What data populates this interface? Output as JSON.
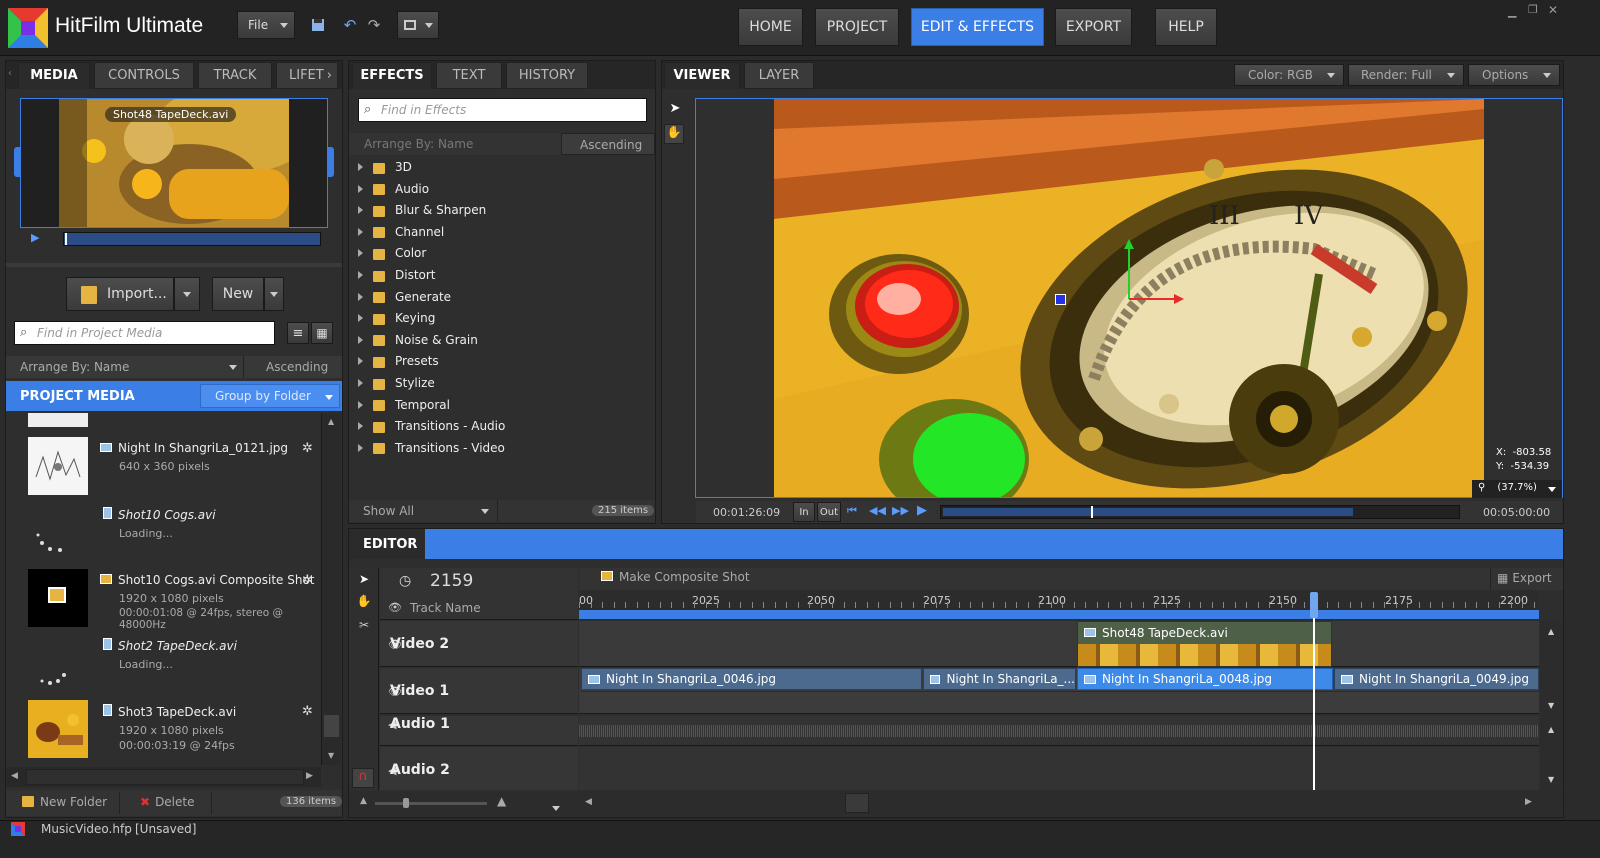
{
  "app": {
    "title": "HitFilm Ultimate",
    "file_menu": "File"
  },
  "nav": {
    "tabs": [
      "HOME",
      "PROJECT",
      "EDIT & EFFECTS",
      "EXPORT",
      "HELP"
    ],
    "active": "EDIT & EFFECTS"
  },
  "left_tabs": [
    "MEDIA",
    "CONTROLS",
    "TRACK",
    "LIFET"
  ],
  "preview": {
    "label": "Shot48 TapeDeck.avi"
  },
  "media_buttons": {
    "import": "Import...",
    "new": "New"
  },
  "media_search": {
    "placeholder": "Find in Project Media"
  },
  "media_arrange": {
    "label": "Arrange By: Name",
    "order": "Ascending"
  },
  "project_media": {
    "title": "PROJECT MEDIA",
    "group": "Group by Folder"
  },
  "media_items": [
    {
      "name": "Night In ShangriLa_0121.jpg",
      "line1": "640 x 360 pixels",
      "line2": "",
      "italic": false
    },
    {
      "name": "Shot10 Cogs.avi",
      "line1": "Loading...",
      "line2": "",
      "italic": true
    },
    {
      "name": "Shot10 Cogs.avi Composite Shot",
      "line1": "1920 x 1080 pixels",
      "line2": "00:00:01:08 @ 24fps, stereo @ 48000Hz",
      "italic": false
    },
    {
      "name": "Shot2 TapeDeck.avi",
      "line1": "Loading...",
      "line2": "",
      "italic": true
    },
    {
      "name": "Shot3 TapeDeck.avi",
      "line1": "1920 x 1080 pixels",
      "line2": "00:00:03:19 @ 24fps",
      "italic": false
    }
  ],
  "media_footer": {
    "new_folder": "New Folder",
    "delete": "Delete",
    "count": "136 items"
  },
  "effects_tabs": [
    "EFFECTS",
    "TEXT",
    "HISTORY"
  ],
  "effects_search": {
    "placeholder": "Find in Effects"
  },
  "effects_arrange": {
    "label": "Arrange By: Name",
    "order": "Ascending"
  },
  "effect_folders": [
    "3D",
    "Audio",
    "Blur & Sharpen",
    "Channel",
    "Color",
    "Distort",
    "Generate",
    "Keying",
    "Noise & Grain",
    "Presets",
    "Stylize",
    "Temporal",
    "Transitions - Audio",
    "Transitions - Video"
  ],
  "effects_footer": {
    "show": "Show All",
    "count": "215 items"
  },
  "viewer_tabs": [
    "VIEWER",
    "LAYER"
  ],
  "viewer_options": {
    "color": "Color: RGB",
    "render": "Render: Full",
    "options": "Options"
  },
  "viewer_coords": {
    "x": "X:  -803.58",
    "y": "Y:  -534.39",
    "zoom": "(37.7%)"
  },
  "transport": {
    "current": "00:01:26:09",
    "in": "In",
    "out": "Out",
    "duration": "00:05:00:00"
  },
  "editor": {
    "title": "EDITOR",
    "frame": "2159",
    "composite": "Make Composite Shot",
    "export": "Export",
    "track_name": "Track Name"
  },
  "ruler": [
    "00",
    "2025",
    "2050",
    "2075",
    "2100",
    "2125",
    "2150",
    "2175",
    "2200"
  ],
  "tracks": [
    "Video 2",
    "Video 1",
    "Audio 1",
    "Audio 2"
  ],
  "clips": {
    "v2": "Shot48 TapeDeck.avi",
    "v1a": "Night In ShangriLa_0046.jpg",
    "v1b": "Night In ShangriLa_...",
    "v1c": "Night In ShangriLa_0048.jpg",
    "v1d": "Night In ShangriLa_0049.jpg"
  },
  "status": {
    "file": "MusicVideo.hfp",
    "state": "[Unsaved]"
  },
  "colors": {
    "accent": "#3a7ee6",
    "folder": "#e6b441",
    "clip": "#4b6a8e",
    "clip_selected": "#3d8ae8"
  }
}
